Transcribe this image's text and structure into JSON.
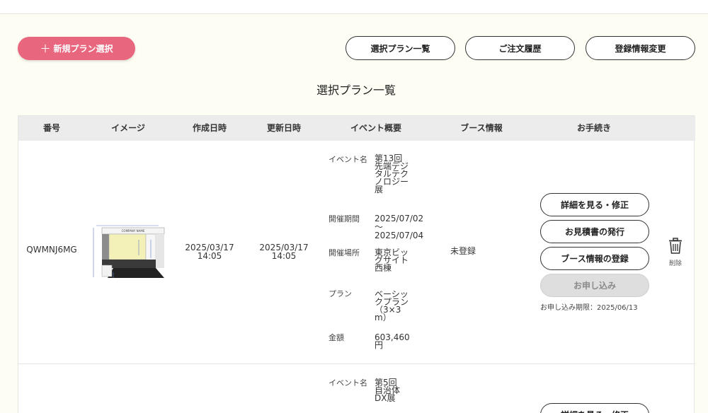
{
  "header": {
    "new_plan_label": "新規プラン選択",
    "nav": {
      "selected_plans": "選択プラン一覧",
      "order_history": "ご注文履歴",
      "profile_edit": "登録情報変更"
    }
  },
  "page_title": "選択プラン一覧",
  "table": {
    "headers": [
      "番号",
      "イメージ",
      "作成日時",
      "更新日時",
      "イベント概要",
      "ブース情報",
      "お手続き"
    ],
    "rows": [
      {
        "id": "QWMNJ6MG",
        "thumb_text": "COMPANY NAME",
        "created": [
          "2025/03/17",
          "14:05"
        ],
        "updated": [
          "2025/03/17",
          "14:05"
        ],
        "event": {
          "name_label": "イベント名",
          "name": "第13回先端デジタルテクノロジー展",
          "period_label": "開催期間",
          "period_start": "2025/07/02",
          "period_sep": "〜",
          "period_end": "2025/07/04",
          "venue_label": "開催場所",
          "venue": "東京ビッグサイト西棟",
          "plan_label": "プラン",
          "plan": "ベーシックプラン（3×3m）",
          "price_label": "金額",
          "price": "603,460円"
        },
        "booth": "未登録",
        "actions": {
          "view_edit": "詳細を見る・修正",
          "issue_estimate": "お見積書の発行",
          "register_booth": "ブース情報の登録",
          "apply": "お申し込み",
          "deadline": "お申し込み期限：2025/06/13"
        },
        "delete_label": "削除"
      },
      {
        "event": {
          "name_label": "イベント名",
          "name": "第5回自治体DX展"
        },
        "actions": {
          "view_edit": "詳細を見る・修正"
        }
      }
    ]
  },
  "colors": {
    "accent": "#e8677f",
    "background": "#fdfdf3",
    "header_row": "#ececec"
  }
}
